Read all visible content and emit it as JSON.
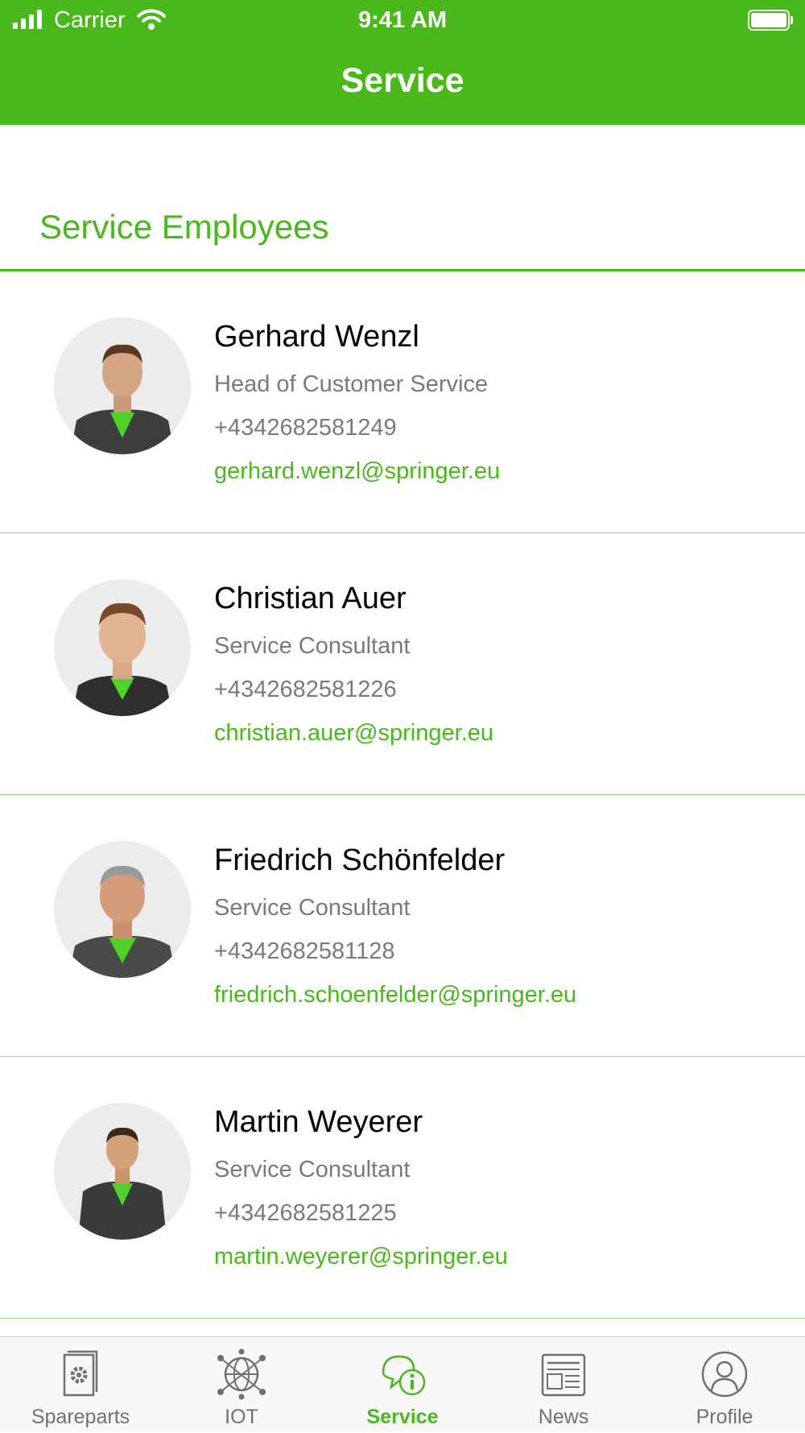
{
  "status_bar": {
    "carrier": "Carrier",
    "time": "9:41 AM"
  },
  "nav": {
    "title": "Service"
  },
  "section": {
    "title": "Service Employees"
  },
  "employees": [
    {
      "name": "Gerhard Wenzl",
      "role": "Head of Customer Service",
      "phone": "+4342682581249",
      "email": "gerhard.wenzl@springer.eu"
    },
    {
      "name": "Christian Auer",
      "role": "Service Consultant",
      "phone": "+4342682581226",
      "email": "christian.auer@springer.eu"
    },
    {
      "name": "Friedrich Schönfelder",
      "role": "Service Consultant",
      "phone": "+4342682581128",
      "email": "friedrich.schoenfelder@springer.eu"
    },
    {
      "name": "Martin Weyerer",
      "role": "Service Consultant",
      "phone": "+4342682581225",
      "email": "martin.weyerer@springer.eu"
    }
  ],
  "tabs": [
    {
      "label": "Spareparts",
      "icon": "book-gear-icon"
    },
    {
      "label": "IOT",
      "icon": "network-globe-icon"
    },
    {
      "label": "Service",
      "icon": "chat-info-icon",
      "active": true
    },
    {
      "label": "News",
      "icon": "newspaper-icon"
    },
    {
      "label": "Profile",
      "icon": "user-circle-icon"
    }
  ],
  "colors": {
    "accent": "#48b81b",
    "text_secondary": "#7a7a7a",
    "tab_inactive": "#707070"
  }
}
